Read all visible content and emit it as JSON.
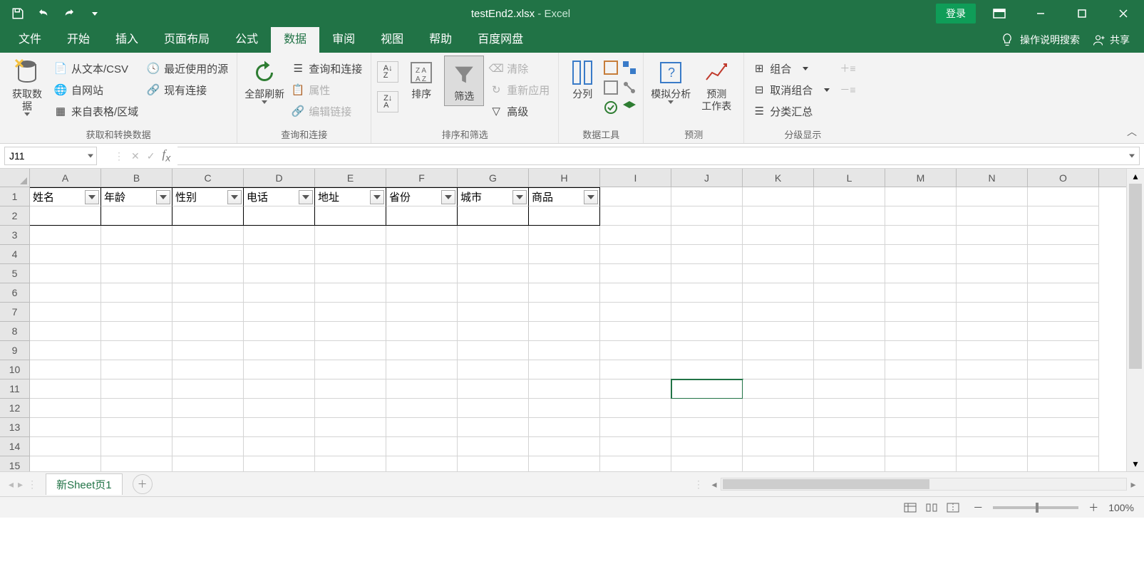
{
  "title": {
    "file": "testEnd2.xlsx",
    "separator": " - ",
    "app": "Excel",
    "login": "登录"
  },
  "tabs": {
    "items": [
      "文件",
      "开始",
      "插入",
      "页面布局",
      "公式",
      "数据",
      "审阅",
      "视图",
      "帮助",
      "百度网盘"
    ],
    "active": 5,
    "tell_me": "操作说明搜索",
    "share": "共享"
  },
  "ribbon": {
    "g1": {
      "label": "获取和转换数据",
      "get_data": "获取数\n据",
      "from_text": "从文本/CSV",
      "from_web": "自网站",
      "from_table": "来自表格/区域",
      "recent": "最近使用的源",
      "existing": "现有连接"
    },
    "g2": {
      "label": "查询和连接",
      "refresh": "全部刷新",
      "queries": "查询和连接",
      "props": "属性",
      "edit_links": "编辑链接"
    },
    "g3": {
      "label": "排序和筛选",
      "sort": "排序",
      "filter": "筛选",
      "clear": "清除",
      "reapply": "重新应用",
      "advanced": "高级"
    },
    "g4": {
      "label": "数据工具",
      "text_to_cols": "分列"
    },
    "g5": {
      "label": "预测",
      "whatif": "模拟分析",
      "forecast": "预测\n工作表"
    },
    "g6": {
      "label": "分级显示",
      "group": "组合",
      "ungroup": "取消组合",
      "subtotal": "分类汇总"
    }
  },
  "formula_bar": {
    "name_box": "J11",
    "formula": ""
  },
  "grid": {
    "columns": [
      "A",
      "B",
      "C",
      "D",
      "E",
      "F",
      "G",
      "H",
      "I",
      "J",
      "K",
      "L",
      "M",
      "N",
      "O"
    ],
    "row_count": 15,
    "header_row": [
      "姓名",
      "年龄",
      "性别",
      "电话",
      "地址",
      "省份",
      "城市",
      "商品"
    ],
    "selected_cell": "J11"
  },
  "sheet": {
    "name": "新Sheet页1"
  },
  "status": {
    "zoom": "100%"
  }
}
